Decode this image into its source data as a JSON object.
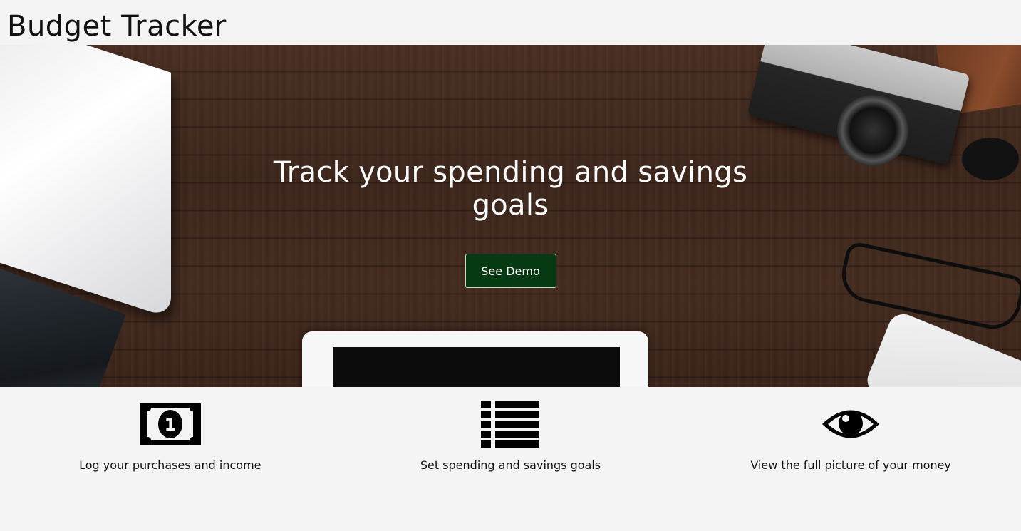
{
  "header": {
    "title": "Budget Tracker"
  },
  "hero": {
    "heading": "Track your spending and savings goals",
    "button_label": "See Demo"
  },
  "features": [
    {
      "icon": "money-bill-icon",
      "label": "Log your purchases and income"
    },
    {
      "icon": "list-icon",
      "label": "Set spending and savings goals"
    },
    {
      "icon": "eye-icon",
      "label": "View the full picture of your money"
    }
  ],
  "colors": {
    "background": "#f4f4f4",
    "button": "#053a12",
    "hero_text": "#ffffff"
  }
}
